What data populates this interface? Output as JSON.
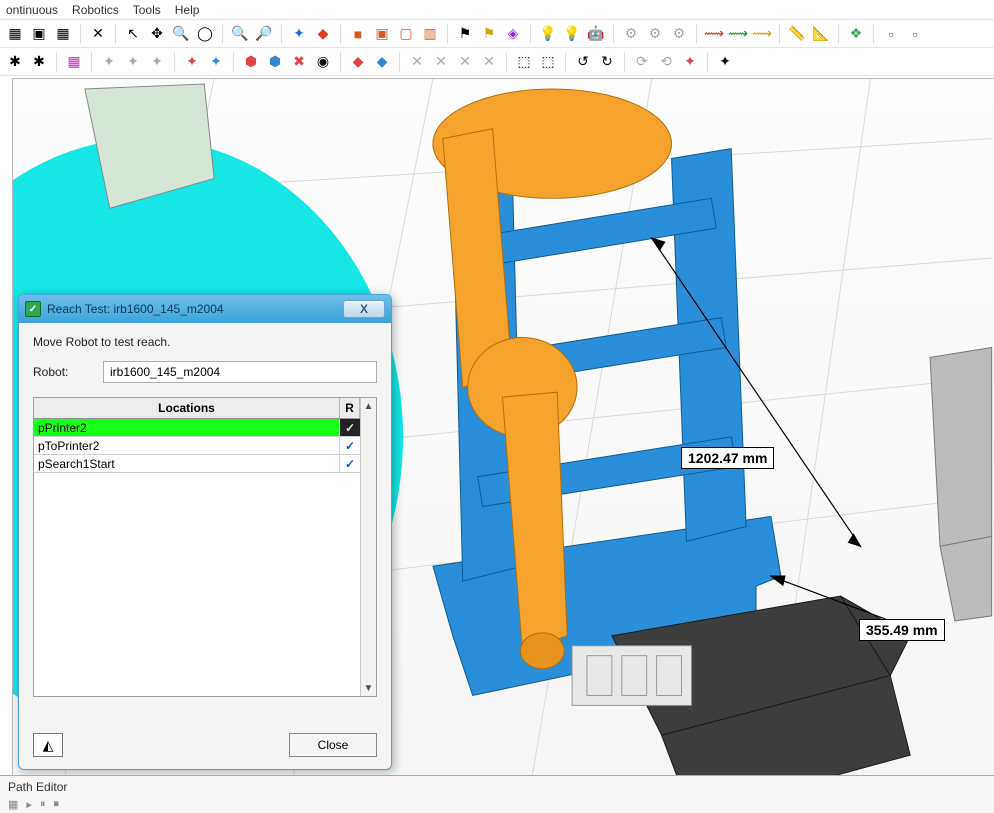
{
  "menubar": {
    "items": [
      "ontinuous",
      "Robotics",
      "Tools",
      "Help"
    ]
  },
  "dialog": {
    "title": "Reach Test: irb1600_145_m2004",
    "instruction": "Move Robot to test reach.",
    "robot_label": "Robot:",
    "robot_value": "irb1600_145_m2004",
    "header_locations": "Locations",
    "header_r": "R",
    "rows": [
      {
        "name": "pPrinter2",
        "r": "✓",
        "selected": true
      },
      {
        "name": "pToPrinter2",
        "r": "✓",
        "selected": false
      },
      {
        "name": "pSearch1Start",
        "r": "✓",
        "selected": false
      }
    ],
    "close_label": "Close"
  },
  "dimensions": {
    "a": "1202.47 mm",
    "b": "355.49 mm"
  },
  "bottom_panel": {
    "title": "Path Editor"
  }
}
